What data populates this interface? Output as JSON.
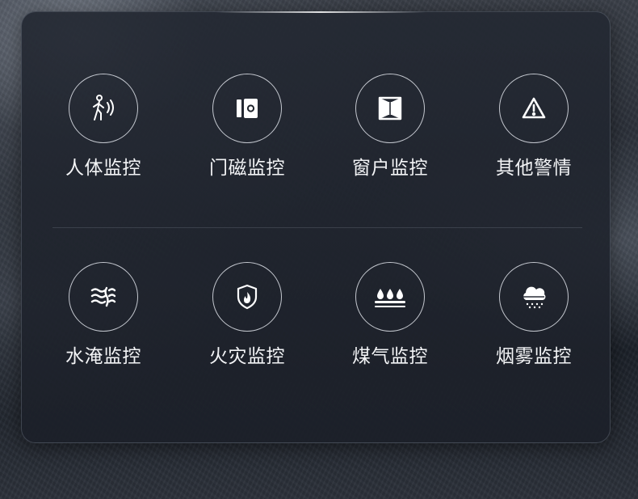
{
  "items": [
    {
      "label": "人体监控",
      "icon": "human-motion-icon"
    },
    {
      "label": "门磁监控",
      "icon": "door-sensor-icon"
    },
    {
      "label": "窗户监控",
      "icon": "window-icon"
    },
    {
      "label": "其他警情",
      "icon": "warning-icon"
    },
    {
      "label": "水淹监控",
      "icon": "water-flood-icon"
    },
    {
      "label": "火灾监控",
      "icon": "fire-shield-icon"
    },
    {
      "label": "煤气监控",
      "icon": "gas-drops-icon"
    },
    {
      "label": "烟雾监控",
      "icon": "smoke-cloud-icon"
    }
  ],
  "colors": {
    "panel": "#242933",
    "text": "#f3f4f6",
    "ring": "#e1e4eb"
  }
}
